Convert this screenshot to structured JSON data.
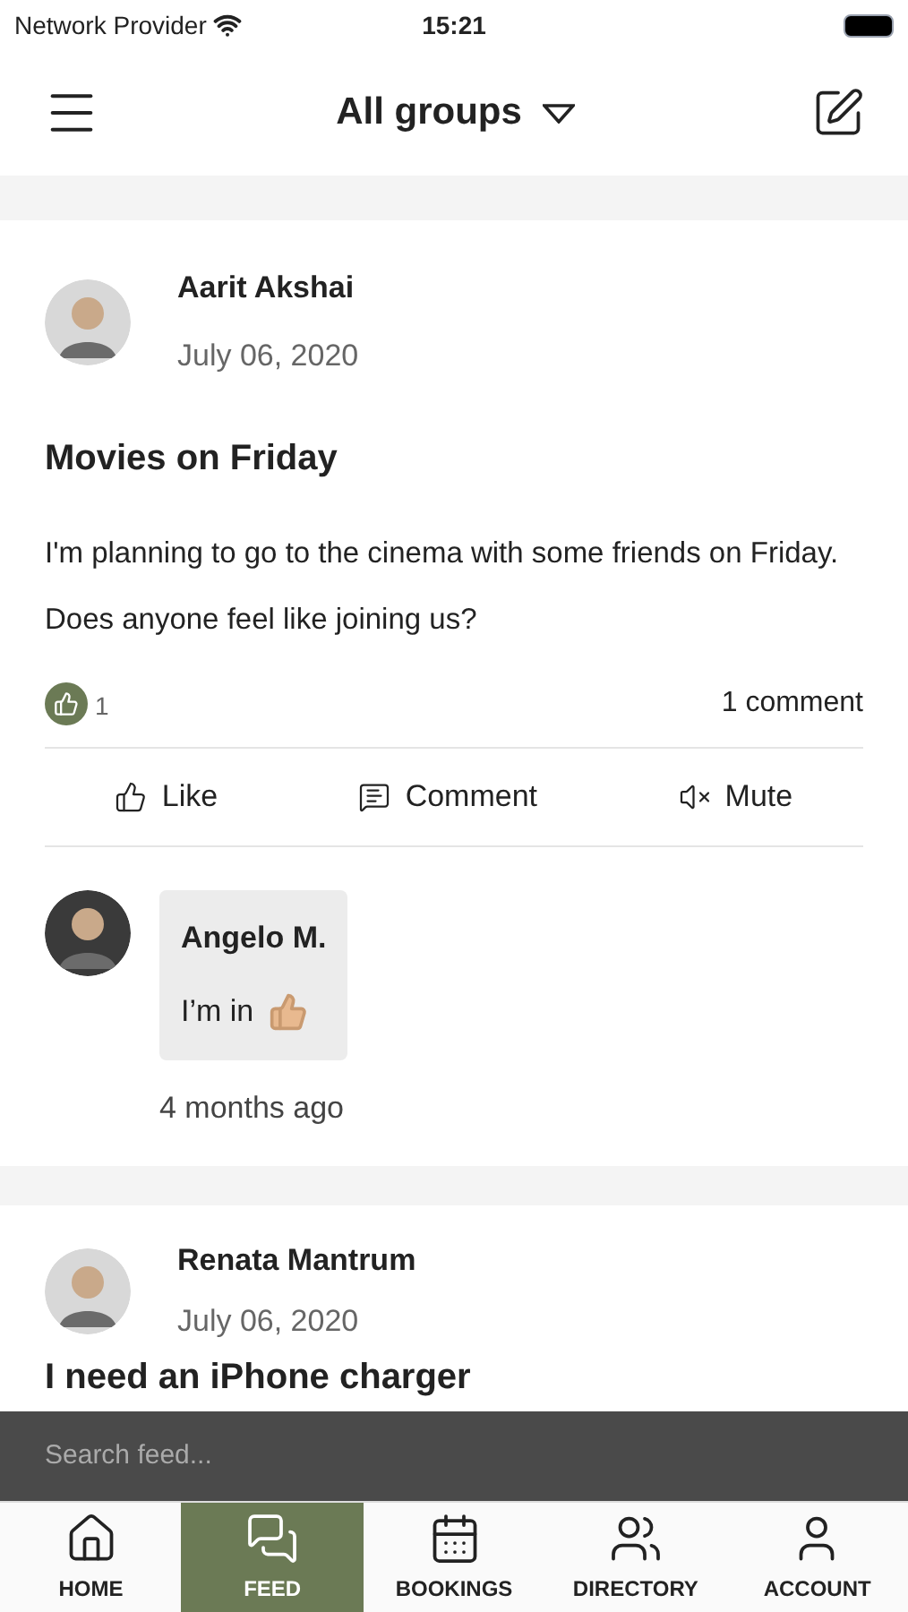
{
  "status_bar": {
    "carrier": "Network Provider",
    "time": "15:21"
  },
  "header": {
    "title": "All groups"
  },
  "posts": [
    {
      "author": "Aarit Akshai",
      "date": "July 06, 2020",
      "title": "Movies on Friday",
      "body": "I'm planning to go to the cinema with some friends on Friday. Does anyone feel like joining us?",
      "like_count": "1",
      "comment_count": "1 comment",
      "actions": [
        "Like",
        "Comment",
        "Mute"
      ],
      "comments": [
        {
          "author": "Angelo M.",
          "text": "I’m in",
          "time": "4 months ago"
        }
      ]
    },
    {
      "author": "Renata Mantrum",
      "date": "July 06, 2020",
      "title": "I need an iPhone charger"
    }
  ],
  "search": {
    "placeholder": "Search feed..."
  },
  "tabs": [
    {
      "label": "HOME",
      "selected": false
    },
    {
      "label": "FEED",
      "selected": true
    },
    {
      "label": "BOOKINGS",
      "selected": false
    },
    {
      "label": "DIRECTORY",
      "selected": false
    },
    {
      "label": "ACCOUNT",
      "selected": false
    }
  ]
}
